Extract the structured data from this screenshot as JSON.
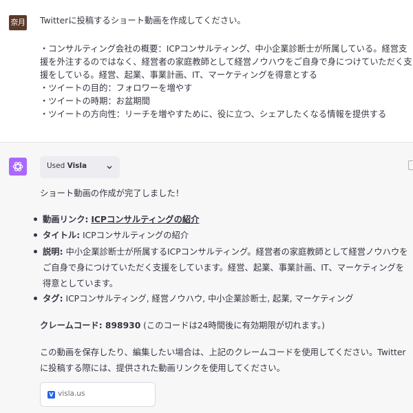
{
  "user": {
    "avatar_text": "奈月",
    "lines": [
      "Twitterに投稿するショート動画を作成してください。",
      "・コンサルティング会社の概要：ICPコンサルティング、中小企業診断士が所属している。経営支",
      "援を外注するのではなく、経営者の家庭教師として経営ノウハウをご自身で身につけていただく支",
      "援をしている。経営、起業、事業計画、IT、マーケティングを得意とする",
      "・ツイートの目的：フォロワーを増やす",
      "・ツイートの時期：お盆期間",
      "・ツイートの方向性：リーチを増やすために、役に立つ、シェアしたくなる情報を提供する"
    ]
  },
  "assistant": {
    "tool_used_prefix": "Used",
    "tool_name": "Visla",
    "intro": "ショート動画の作成が完了しました！",
    "items": {
      "link_label": "動画リンク:",
      "link_text": "ICPコンサルティングの紹介",
      "title_label": "タイトル:",
      "title_value": "ICPコンサルティングの紹介",
      "desc_label": "説明:",
      "desc_line1": "中小企業診断士が所属するICPコンサルティング。経営者の家庭教師として経営ノウハウを",
      "desc_line2": "ご自身で身につけていただく支援をしています。経営、起業、事業計画、IT、マーケティングを",
      "desc_line3": "得意としています。",
      "tags_label": "タグ:",
      "tags_value": "ICPコンサルティング, 経営ノウハウ, 中小企業診断士, 起業, マーケティング"
    },
    "claim_label": "クレームコード: 898930",
    "claim_note": "(このコードは24時間後に有効期限が切れます。)",
    "outro_line1": "この動画を保存したり、編集したい場合は、上記のクレームコードを使用してください。Twitter",
    "outro_line2": "に投稿する際には、提供された動画リンクを使用してください。",
    "link_card_host": "visla.us",
    "brand_color": "#ab68ff"
  }
}
